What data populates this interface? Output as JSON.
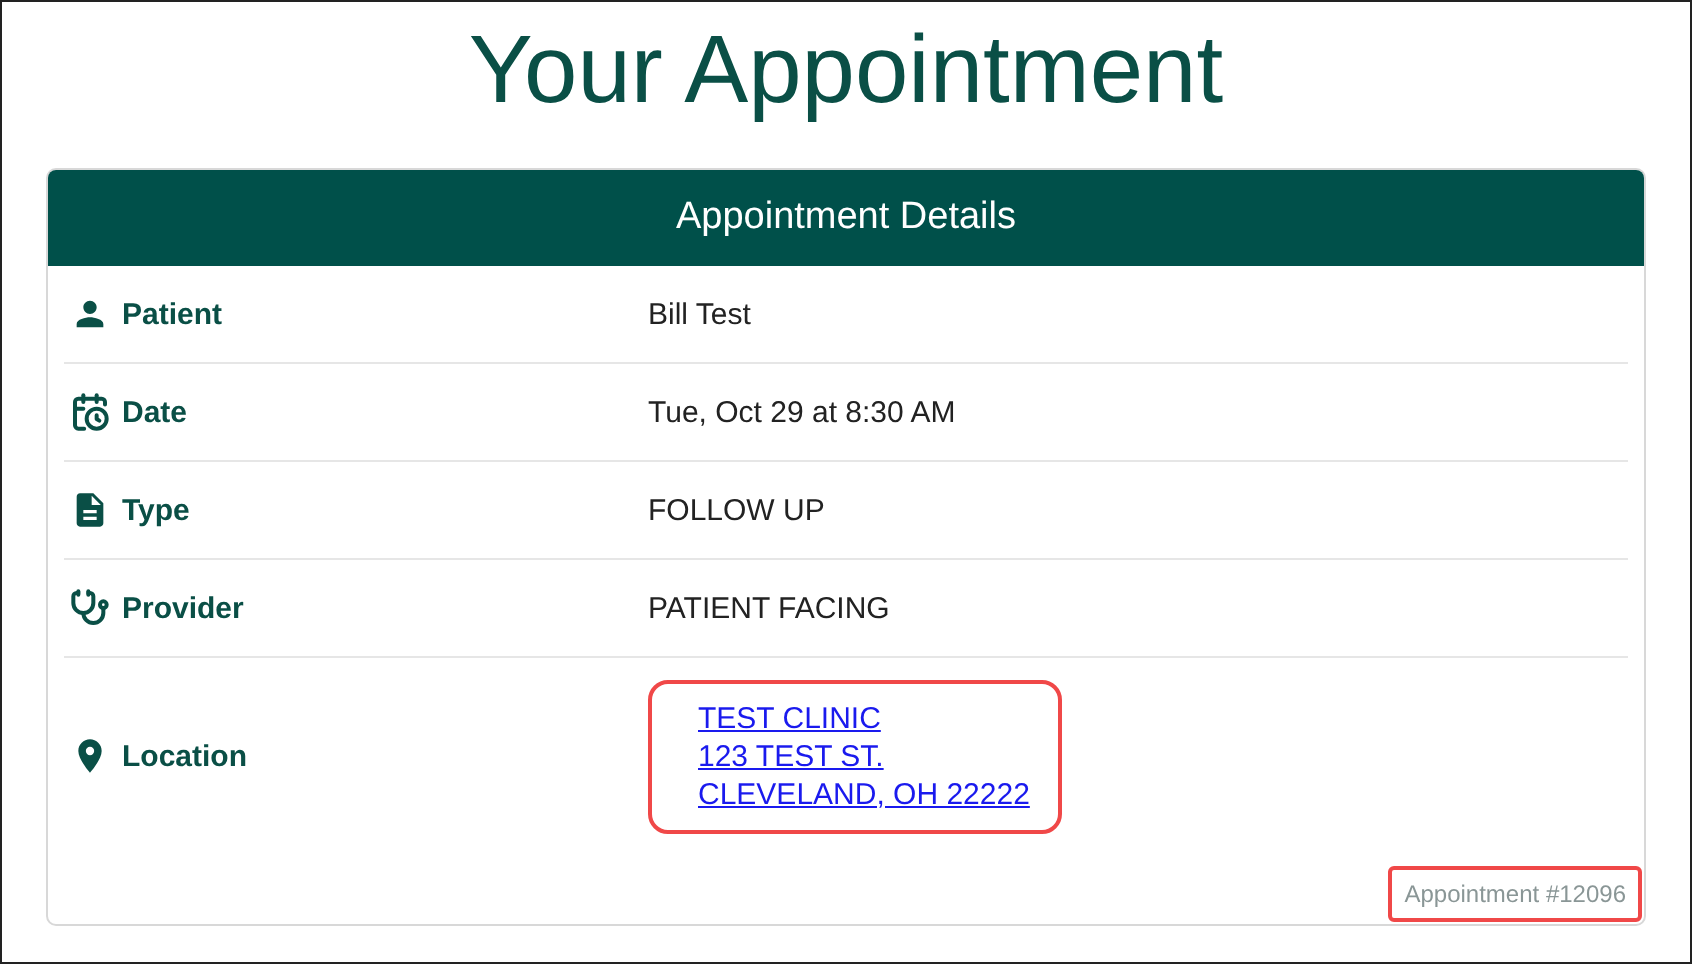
{
  "page": {
    "title": "Your Appointment"
  },
  "card": {
    "title": "Appointment Details",
    "rows": [
      {
        "kind": "text",
        "label": "Patient",
        "value": "Bill Test"
      },
      {
        "kind": "text",
        "label": "Date",
        "value": "Tue, Oct 29 at 8:30 AM"
      },
      {
        "kind": "text",
        "label": "Type",
        "value": "FOLLOW UP"
      },
      {
        "kind": "text",
        "label": "Provider",
        "value": "PATIENT FACING"
      },
      {
        "kind": "address",
        "label": "Location",
        "highlighted": true,
        "lines": [
          "TEST CLINIC",
          "123 TEST ST.",
          "CLEVELAND, OH 22222"
        ]
      }
    ],
    "footer": {
      "text": "Appointment #12096",
      "highlighted": true
    }
  }
}
